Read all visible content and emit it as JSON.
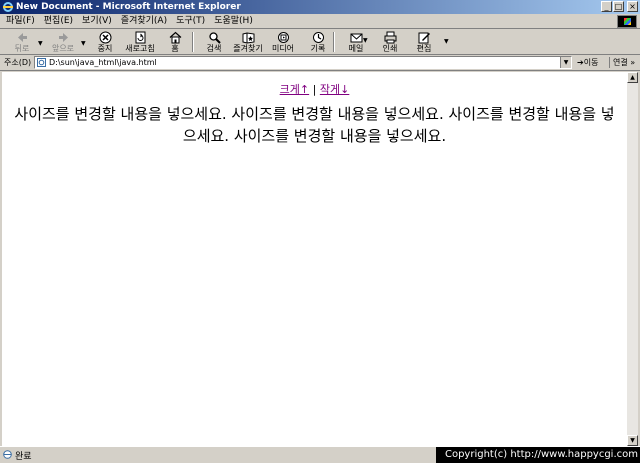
{
  "window": {
    "title": "New Document - Microsoft Internet Explorer",
    "buttons": {
      "minimize": "_",
      "maximize": "□",
      "close": "×"
    }
  },
  "menu": [
    "파일(F)",
    "편집(E)",
    "보기(V)",
    "즐겨찾기(A)",
    "도구(T)",
    "도움말(H)"
  ],
  "toolbar": {
    "back": "뒤로",
    "forward": "앞으로",
    "stop": "중지",
    "refresh": "새로고침",
    "home": "홈",
    "search": "검색",
    "favorites": "즐겨찾기",
    "media": "미디어",
    "history": "기록",
    "mail": "메일",
    "print": "인쇄",
    "edit": "편집"
  },
  "address": {
    "label": "주소(D)",
    "value": "D:\\sun\\java_html\\java.html",
    "go": "이동",
    "links": "연결 »"
  },
  "content": {
    "bigger_link": "크게↑",
    "separator": "|",
    "smaller_link": "작게↓",
    "text": "사이즈를 변경할 내용을 넣으세요. 사이즈를 변경할 내용을 넣으세요. 사이즈를 변경할 내용을 넣으세요. 사이즈를 변경할 내용을 넣으세요."
  },
  "status": {
    "text": "완료",
    "copyright": "Copyright(c) http://www.happycgi.com"
  }
}
